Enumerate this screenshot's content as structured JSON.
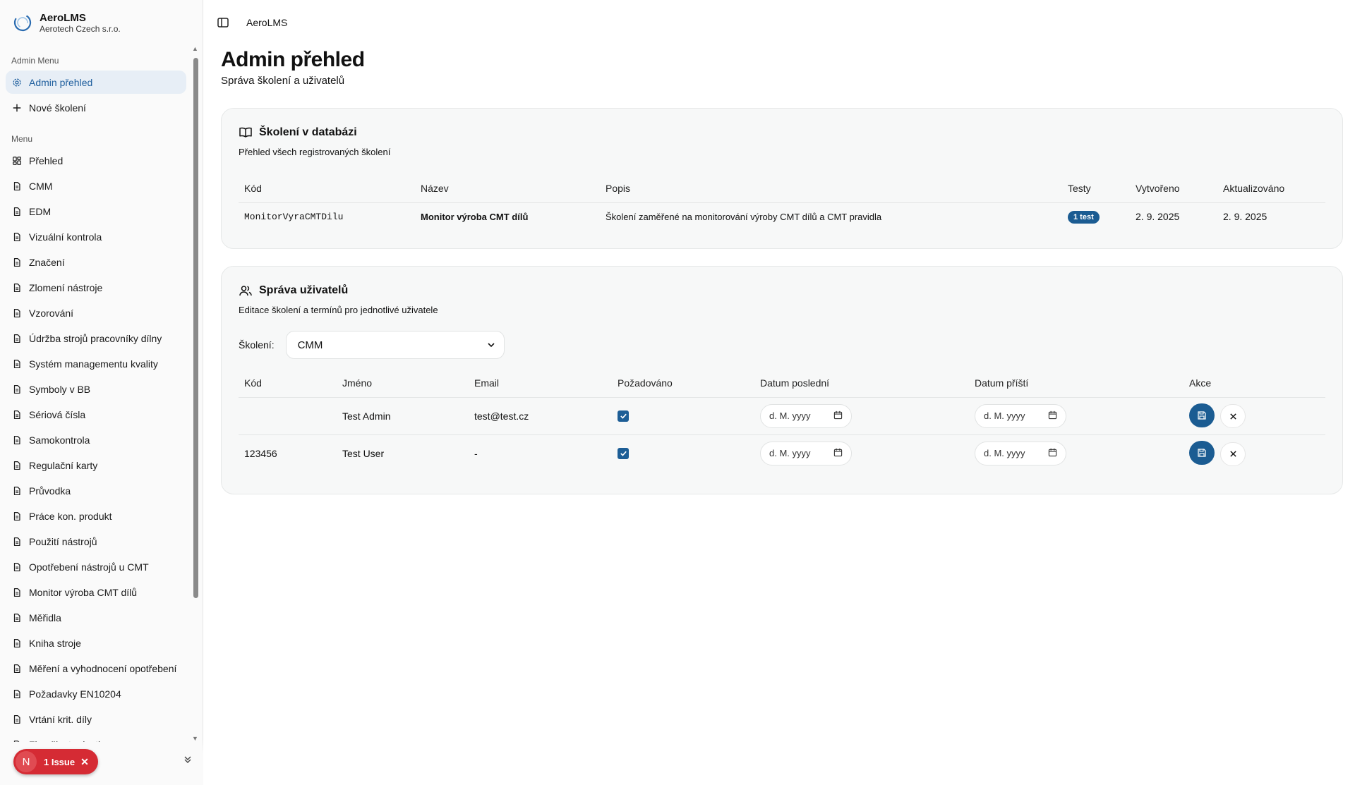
{
  "brand": {
    "name": "AeroLMS",
    "company": "Aerotech Czech s.r.o."
  },
  "sidebar": {
    "admin_group_label": "Admin Menu",
    "admin_items": [
      {
        "label": "Admin přehled",
        "icon": "settings-icon",
        "active": true
      },
      {
        "label": "Nové školení",
        "icon": "plus-icon",
        "active": false
      }
    ],
    "menu_group_label": "Menu",
    "menu_items": [
      {
        "label": "Přehled",
        "icon": "dashboard-icon"
      },
      {
        "label": "CMM",
        "icon": "document-icon"
      },
      {
        "label": "EDM",
        "icon": "document-icon"
      },
      {
        "label": "Vizuální kontrola",
        "icon": "document-icon"
      },
      {
        "label": "Značení",
        "icon": "document-icon"
      },
      {
        "label": "Zlomení nástroje",
        "icon": "document-icon"
      },
      {
        "label": "Vzorování",
        "icon": "document-icon"
      },
      {
        "label": "Údržba strojů pracovníky dílny",
        "icon": "document-icon"
      },
      {
        "label": "Systém managementu kvality",
        "icon": "document-icon"
      },
      {
        "label": "Symboly v BB",
        "icon": "document-icon"
      },
      {
        "label": "Sériová čísla",
        "icon": "document-icon"
      },
      {
        "label": "Samokontrola",
        "icon": "document-icon"
      },
      {
        "label": "Regulační karty",
        "icon": "document-icon"
      },
      {
        "label": "Průvodka",
        "icon": "document-icon"
      },
      {
        "label": "Práce kon. produkt",
        "icon": "document-icon"
      },
      {
        "label": "Použití nástrojů",
        "icon": "document-icon"
      },
      {
        "label": "Opotřebení nástrojů u CMT",
        "icon": "document-icon"
      },
      {
        "label": "Monitor výroba CMT dílů",
        "icon": "document-icon"
      },
      {
        "label": "Měřidla",
        "icon": "document-icon"
      },
      {
        "label": "Kniha stroje",
        "icon": "document-icon"
      },
      {
        "label": "Měření a vyhodnocení opotřebení",
        "icon": "document-icon"
      },
      {
        "label": "Požadavky EN10204",
        "icon": "document-icon"
      },
      {
        "label": "Vrtání krit. díly",
        "icon": "document-icon"
      },
      {
        "label": "Zkoušky tvrdosti",
        "icon": "document-icon"
      }
    ]
  },
  "issue_badge": {
    "letter": "N",
    "label": "1 Issue"
  },
  "topbar": {
    "title": "AeroLMS"
  },
  "page": {
    "title": "Admin přehled",
    "subtitle": "Správa školení a uživatelů"
  },
  "trainings_card": {
    "title": "Školení v databázi",
    "subtitle": "Přehled všech registrovaných školení",
    "columns": [
      "Kód",
      "Název",
      "Popis",
      "Testy",
      "Vytvořeno",
      "Aktualizováno"
    ],
    "rows": [
      {
        "code": "MonitorVyraCMTDilu",
        "name": "Monitor výroba CMT dílů",
        "description": "Školení zaměřené na monitorování výroby CMT dílů a CMT pravidla",
        "tests": "1 test",
        "created": "2. 9. 2025",
        "updated": "2. 9. 2025"
      }
    ]
  },
  "users_card": {
    "title": "Správa uživatelů",
    "subtitle": "Editace školení a termínů pro jednotlivé uživatele",
    "select_label": "Školení:",
    "select_value": "CMM",
    "columns": [
      "Kód",
      "Jméno",
      "Email",
      "Požadováno",
      "Datum poslední",
      "Datum příští",
      "Akce"
    ],
    "date_placeholder": "d. M. yyyy",
    "rows": [
      {
        "code": "",
        "name": "Test Admin",
        "email": "test@test.cz",
        "required": true
      },
      {
        "code": "123456",
        "name": "Test User",
        "email": "-",
        "required": true
      }
    ]
  },
  "colors": {
    "accent": "#1b5c92",
    "issue": "#d52b34",
    "active_bg": "#e7eef6"
  }
}
